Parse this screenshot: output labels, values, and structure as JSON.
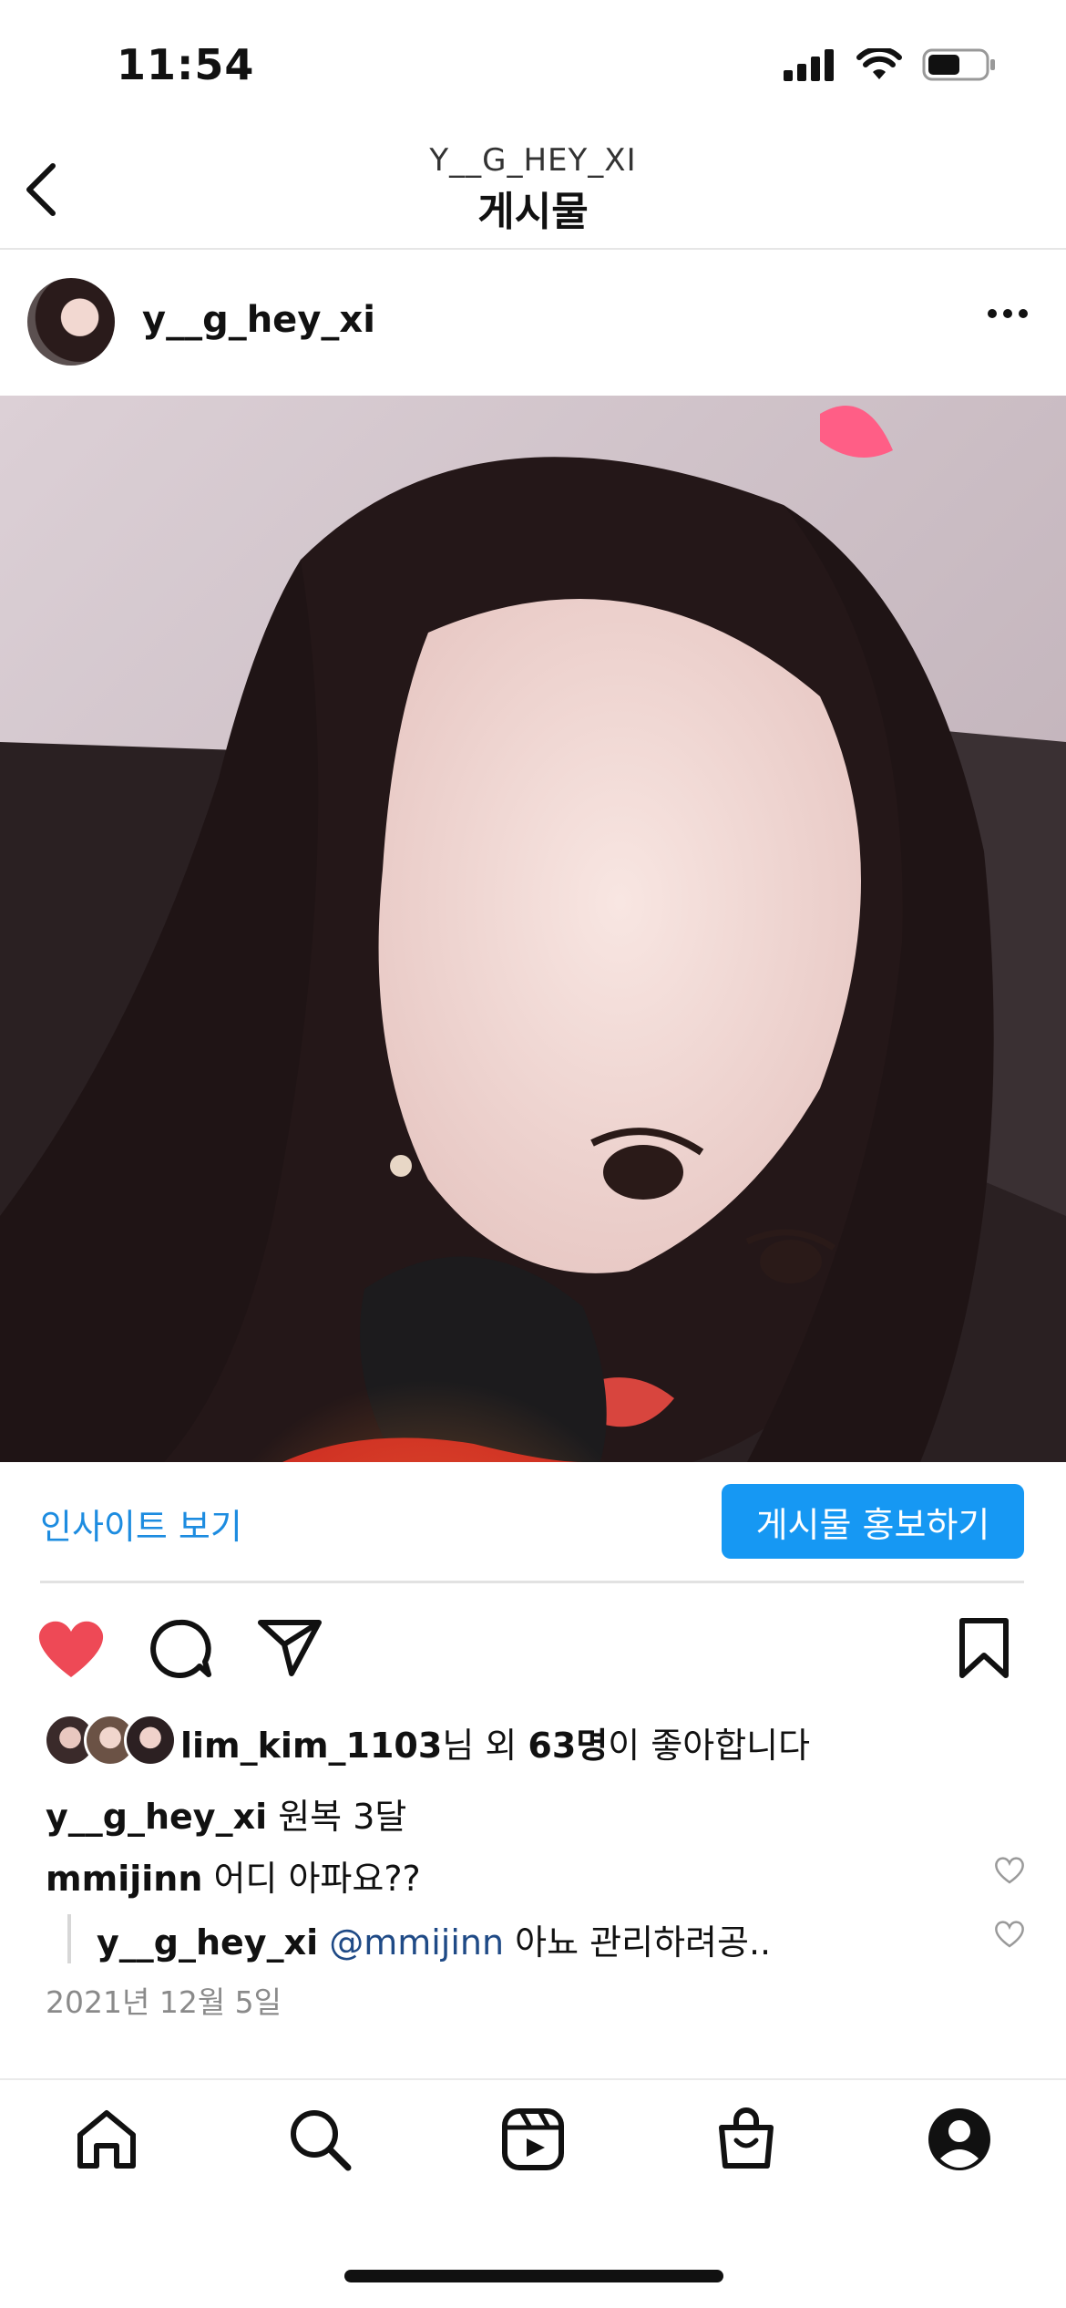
{
  "status_bar": {
    "time": "11:54"
  },
  "header": {
    "subtitle": "Y__G_HEY_XI",
    "title": "게시물"
  },
  "post": {
    "username": "y__g_hey_xi",
    "insights_label": "인사이트 보기",
    "promote_label": "게시물 홍보하기",
    "liked_by_user": "lim_kim_1103",
    "likes_suffix_1": "님 외 ",
    "likes_count": "63명",
    "likes_suffix_2": "이 좋아합니다",
    "caption_user": "y__g_hey_xi",
    "caption_text": " 원복 3달",
    "comments": [
      {
        "user": "mmijinn",
        "text": " 어디 아파요??"
      },
      {
        "user": "y__g_hey_xi",
        "mention": "@mmijinn",
        "text": " 아뇨 관리하려공.."
      }
    ],
    "date": "2021년 12월 5일"
  },
  "nav": {
    "items": [
      "home-icon",
      "search-icon",
      "reels-icon",
      "shop-icon",
      "profile-icon"
    ]
  },
  "colors": {
    "accent": "#1698f3",
    "link": "#1d8ce0",
    "heart": "#ee4956",
    "mention": "#1f4a86"
  }
}
